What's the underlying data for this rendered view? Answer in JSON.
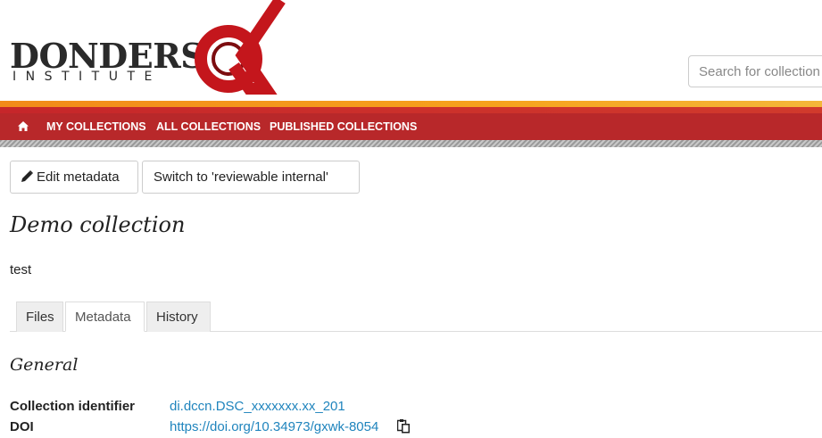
{
  "header": {
    "logo_word": "DONDERS",
    "logo_sub": "INSTITUTE",
    "search_placeholder": "Search for collection"
  },
  "colors": {
    "nav_red": "#b8282a",
    "stripe_orange": "#f28a1a",
    "logo_red": "#c4161c",
    "link_blue": "#1f84bd"
  },
  "nav": {
    "home_icon": "home-icon",
    "items": [
      "MY COLLECTIONS",
      "ALL COLLECTIONS",
      "PUBLISHED COLLECTIONS"
    ]
  },
  "actions": {
    "edit_label": "Edit metadata",
    "edit_icon": "pencil-icon",
    "switch_label": "Switch to 'reviewable internal'"
  },
  "collection": {
    "title": "Demo collection",
    "description": "test"
  },
  "tabs": [
    {
      "label": "Files",
      "active": false
    },
    {
      "label": "Metadata",
      "active": true
    },
    {
      "label": "History",
      "active": false
    }
  ],
  "metadata": {
    "section_title": "General",
    "rows": [
      {
        "label": "Collection identifier",
        "value": "di.dccn.DSC_xxxxxxx.xx_201"
      },
      {
        "label": "DOI",
        "value": "https://doi.org/10.34973/gxwk-8054"
      }
    ],
    "copy_icon": "clipboard-icon"
  }
}
